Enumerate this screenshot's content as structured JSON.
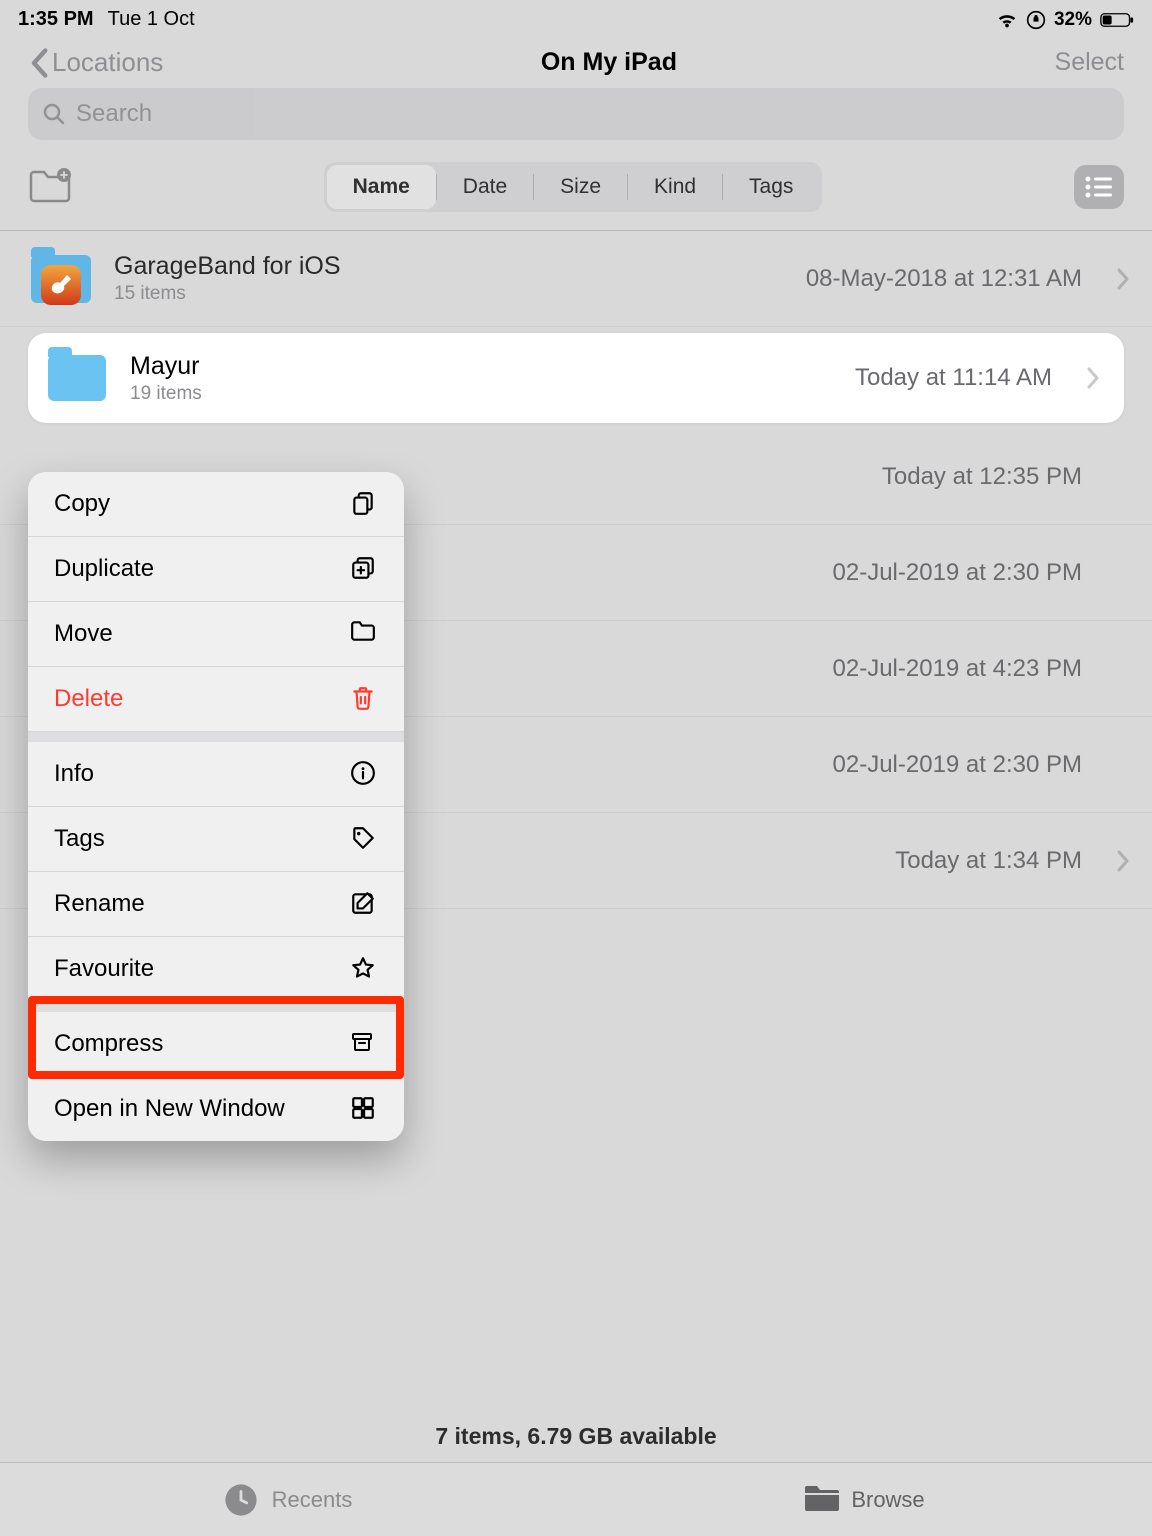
{
  "status": {
    "time": "1:35 PM",
    "date": "Tue 1 Oct",
    "battery_pct": "32%"
  },
  "nav": {
    "back_label": "Locations",
    "title": "On My iPad",
    "select_label": "Select"
  },
  "search": {
    "placeholder": "Search"
  },
  "sort": {
    "options": [
      "Name",
      "Date",
      "Size",
      "Kind",
      "Tags"
    ],
    "selected_index": 0
  },
  "rows": [
    {
      "name": "GarageBand for iOS",
      "sub": "15 items",
      "date": "08-May-2018 at 12:31 AM",
      "icon": "garageband",
      "highlight": false
    },
    {
      "name": "Mayur",
      "sub": "19 items",
      "date": "Today at 11:14 AM",
      "icon": "folder",
      "highlight": true
    },
    {
      "name": "",
      "sub": "",
      "date": "Today at 12:35 PM",
      "icon": "",
      "highlight": false,
      "obscured": true
    },
    {
      "name": "",
      "sub": "",
      "date": "02-Jul-2019 at 2:30 PM",
      "icon": "",
      "highlight": false,
      "obscured": true
    },
    {
      "name": "",
      "sub": "",
      "date": "02-Jul-2019 at 4:23 PM",
      "icon": "",
      "highlight": false,
      "obscured": true
    },
    {
      "name": "",
      "sub": "",
      "date": "02-Jul-2019 at 2:30 PM",
      "icon": "",
      "highlight": false,
      "obscured": true
    },
    {
      "name": "",
      "sub": "",
      "date": "Today at 1:34 PM",
      "icon": "",
      "highlight": false,
      "obscured": true,
      "chevron": true
    }
  ],
  "menu": [
    {
      "label": "Copy",
      "icon": "copy"
    },
    {
      "label": "Duplicate",
      "icon": "duplicate"
    },
    {
      "label": "Move",
      "icon": "folder-outline"
    },
    {
      "label": "Delete",
      "icon": "trash",
      "danger": true
    },
    {
      "label": "Info",
      "icon": "info",
      "sep_above": true
    },
    {
      "label": "Tags",
      "icon": "tag"
    },
    {
      "label": "Rename",
      "icon": "edit"
    },
    {
      "label": "Favourite",
      "icon": "star"
    },
    {
      "label": "Compress",
      "icon": "archive",
      "sep_above": true,
      "annotate": true
    },
    {
      "label": "Open in New Window",
      "icon": "grid"
    }
  ],
  "footer": {
    "summary": "7 items, 6.79 GB available"
  },
  "tabs": {
    "recents": "Recents",
    "browse": "Browse",
    "active": "browse"
  }
}
